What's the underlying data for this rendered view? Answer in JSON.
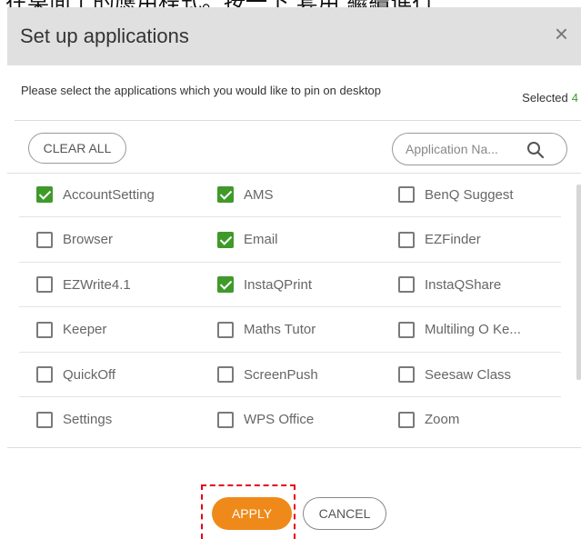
{
  "top_fragment": "在桌面上的應用程式。按一下 套用 繼續進行",
  "dialog": {
    "title": "Set up applications",
    "close_glyph": "×",
    "instruction": "Please select the applications which you would like to pin on desktop",
    "selected_label": "Selected",
    "selected_count": "4"
  },
  "toolbar": {
    "clear_all_label": "CLEAR ALL",
    "search_placeholder": "Application Na...",
    "search_icon": "search-icon"
  },
  "apps": [
    [
      {
        "label": "AccountSetting",
        "checked": true
      },
      {
        "label": "AMS",
        "checked": true
      },
      {
        "label": "BenQ Suggest",
        "checked": false
      }
    ],
    [
      {
        "label": "Browser",
        "checked": false
      },
      {
        "label": "Email",
        "checked": true
      },
      {
        "label": "EZFinder",
        "checked": false
      }
    ],
    [
      {
        "label": "EZWrite4.1",
        "checked": false
      },
      {
        "label": "InstaQPrint",
        "checked": true
      },
      {
        "label": "InstaQShare",
        "checked": false
      }
    ],
    [
      {
        "label": "Keeper",
        "checked": false
      },
      {
        "label": "Maths Tutor",
        "checked": false
      },
      {
        "label": "Multiling O Ke...",
        "checked": false
      }
    ],
    [
      {
        "label": "QuickOff",
        "checked": false
      },
      {
        "label": "ScreenPush",
        "checked": false
      },
      {
        "label": "Seesaw Class",
        "checked": false
      }
    ],
    [
      {
        "label": "Settings",
        "checked": false
      },
      {
        "label": "WPS Office",
        "checked": false
      },
      {
        "label": "Zoom",
        "checked": false
      }
    ]
  ],
  "actions": {
    "apply_label": "APPLY",
    "cancel_label": "CANCEL"
  },
  "colors": {
    "header_bg": "#e0e0e0",
    "check_green": "#3f9a2a",
    "apply_orange": "#ef8a1a",
    "highlight_red": "#e60012"
  }
}
